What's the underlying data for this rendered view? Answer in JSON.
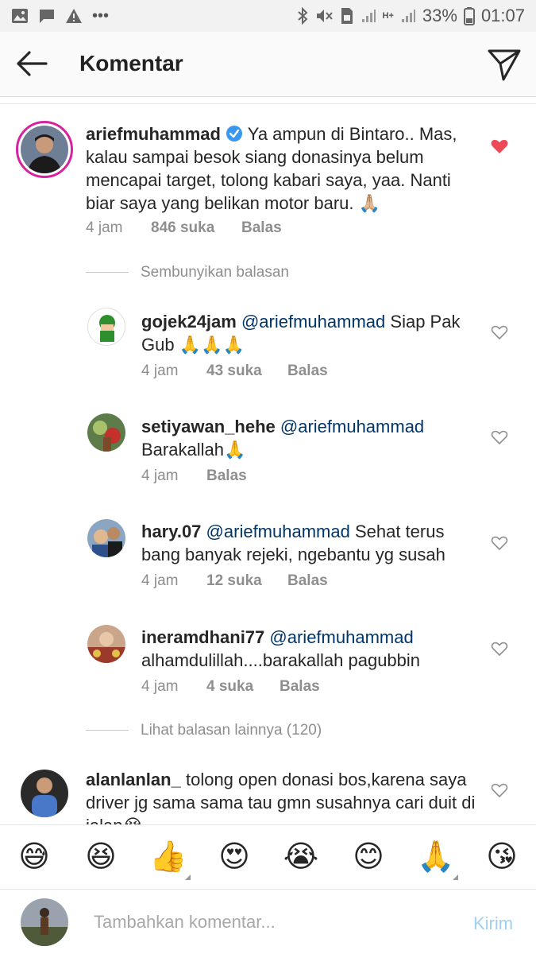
{
  "status": {
    "battery": "33%",
    "time": "01:07",
    "net": "H+"
  },
  "header": {
    "title": "Komentar"
  },
  "comments": [
    {
      "username": "ariefmuhammad",
      "text": "Ya ampun di Bintaro.. Mas, kalau sampai besok siang donasinya belum mencapai target, tolong kabari saya, yaa. Nanti biar saya yang belikan motor baru. 🙏🏼",
      "time": "4 jam",
      "likes": "846 suka",
      "reply": "Balas",
      "verified": true,
      "liked": true
    }
  ],
  "thread": {
    "hide_label": "Sembunyikan balasan",
    "more_label": "Lihat balasan lainnya (120)"
  },
  "replies": [
    {
      "username": "gojek24jam",
      "mention": "@ariefmuhammad",
      "text": "Siap Pak Gub 🙏🙏🙏",
      "time": "4 jam",
      "likes": "43 suka",
      "reply": "Balas"
    },
    {
      "username": "setiyawan_hehe",
      "mention": "@ariefmuhammad",
      "text": "Barakallah🙏",
      "time": "4 jam",
      "likes": "",
      "reply": "Balas"
    },
    {
      "username": "hary.07",
      "mention": "@ariefmuhammad",
      "text": "Sehat terus bang banyak rejeki, ngebantu yg susah",
      "time": "4 jam",
      "likes": "12 suka",
      "reply": "Balas"
    },
    {
      "username": "ineramdhani77",
      "mention": "@ariefmuhammad",
      "text": "alhamdulillah....barakallah pagubbin",
      "time": "4 jam",
      "likes": "4 suka",
      "reply": "Balas"
    }
  ],
  "last_comment": {
    "username": "alanlanlan_",
    "text": "tolong open donasi bos,karena saya driver jg sama sama tau gmn susahnya cari duit di jalan😭"
  },
  "emojis": [
    "😅",
    "😆",
    "👍",
    "😍",
    "😭",
    "😊",
    "🙏",
    "😘"
  ],
  "composer": {
    "placeholder": "Tambahkan komentar...",
    "post_label": "Kirim"
  },
  "colors": {
    "like_red": "#ed4956",
    "mention_blue": "#003569",
    "post_disabled": "#9fd0f0",
    "verified_blue": "#3897f0"
  }
}
